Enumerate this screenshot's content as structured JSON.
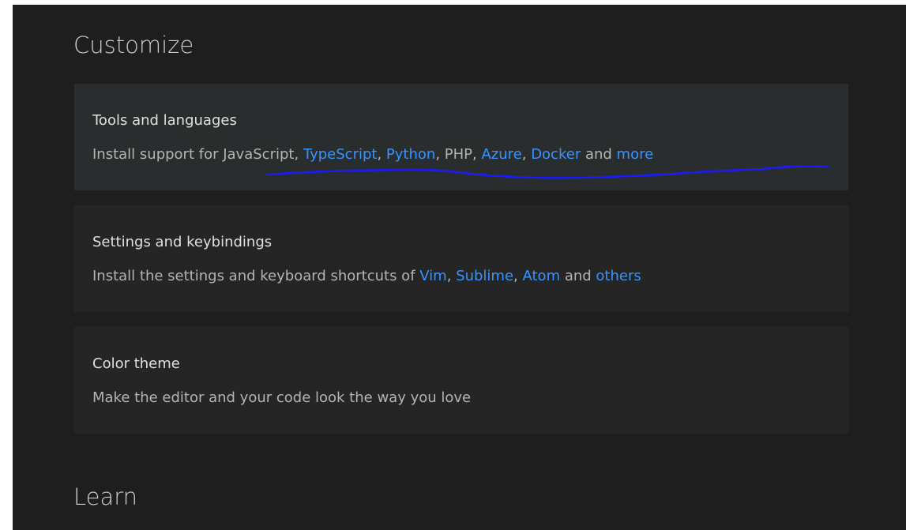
{
  "sections": {
    "customize_title": "Customize",
    "learn_title": "Learn"
  },
  "cards": {
    "tools": {
      "title": "Tools and languages",
      "prefix": "Install support for ",
      "js": "JavaScript",
      "ts": "TypeScript",
      "python": "Python",
      "php": "PHP",
      "azure": "Azure",
      "docker": "Docker",
      "and": " and ",
      "more": "more"
    },
    "settings": {
      "title": "Settings and keybindings",
      "prefix": "Install the settings and keyboard shortcuts of ",
      "vim": "Vim",
      "sublime": "Sublime",
      "atom": "Atom",
      "and": " and ",
      "others": "others"
    },
    "theme": {
      "title": "Color theme",
      "desc": "Make the editor and your code look the way you love"
    }
  },
  "colors": {
    "background": "#1e1e1e",
    "card": "#252526",
    "card_selected": "#2a2d2e",
    "link": "#3794ff",
    "annotation": "#1a1aff"
  }
}
